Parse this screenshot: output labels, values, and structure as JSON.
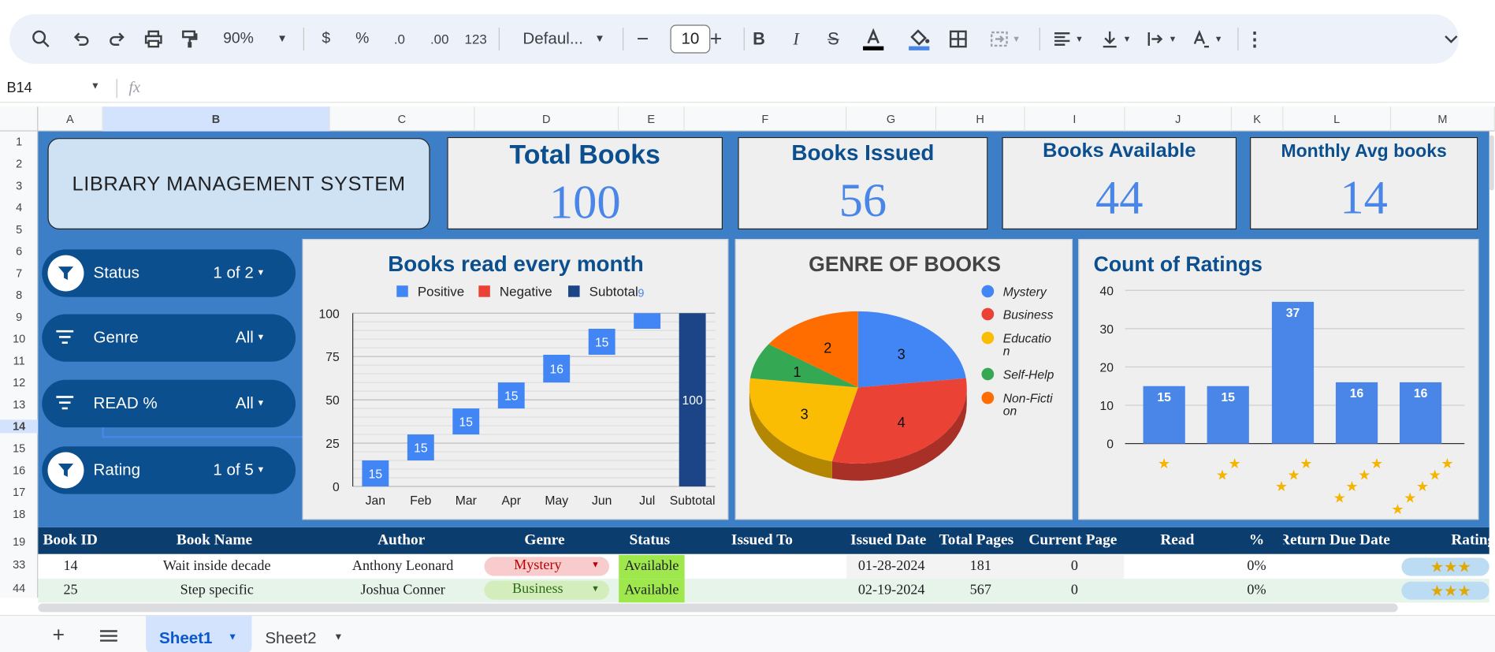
{
  "toolbar": {
    "zoom": "90%",
    "currency": "$",
    "percent": "%",
    "dec_less": ".0",
    "dec_more": ".00",
    "format_123": "123",
    "font": "Defaul...",
    "font_size": "10"
  },
  "formula": {
    "cell_ref": "B14",
    "fx": "fx"
  },
  "columns": [
    "A",
    "B",
    "C",
    "D",
    "E",
    "F",
    "G",
    "H",
    "I",
    "J",
    "K",
    "L",
    "M"
  ],
  "rows": [
    "1",
    "2",
    "3",
    "4",
    "5",
    "6",
    "7",
    "8",
    "9",
    "10",
    "11",
    "12",
    "13",
    "14",
    "15",
    "16",
    "17",
    "18",
    "19",
    "33",
    "44"
  ],
  "title": "LIBRARY MANAGEMENT SYSTEM",
  "kpis": [
    {
      "title": "Total Books",
      "value": "100"
    },
    {
      "title": "Books Issued",
      "value": "56"
    },
    {
      "title": "Books Available",
      "value": "44"
    },
    {
      "title": "Monthly Avg books",
      "value": "14"
    }
  ],
  "filters": [
    {
      "label": "Status",
      "value": "1 of 2",
      "icon": "funnel-icon"
    },
    {
      "label": "Genre",
      "value": "All",
      "icon": "filter-lines-icon"
    },
    {
      "label": "READ %",
      "value": "All",
      "icon": "filter-lines-icon"
    },
    {
      "label": "Rating",
      "value": "1 of 5",
      "icon": "funnel-icon"
    }
  ],
  "chart_data": [
    {
      "type": "bar",
      "title": "Books read every month",
      "legend": [
        "Positive",
        "Negative",
        "Subtotal"
      ],
      "legend_page": "9",
      "colors": {
        "positive": "#4285f4",
        "negative": "#ea4335",
        "subtotal": "#1c4587"
      },
      "categories": [
        "Jan",
        "Feb",
        "Mar",
        "Apr",
        "May",
        "Jun",
        "Jul",
        "Subtotal"
      ],
      "values": [
        15,
        15,
        15,
        15,
        16,
        15,
        9,
        100
      ],
      "labels": [
        "15",
        "15",
        "15",
        "15",
        "16",
        "15",
        "",
        "100"
      ],
      "ylim": [
        0,
        100
      ],
      "yticks": [
        "0",
        "25",
        "50",
        "75",
        "100"
      ]
    },
    {
      "type": "pie",
      "title": "GENRE OF BOOKS",
      "labels": [
        "Mystery",
        "Business",
        "Educatio n",
        "Self-Help",
        "Non-Ficti on"
      ],
      "values": [
        3,
        4,
        3,
        1,
        2
      ],
      "value_labels": [
        "3",
        "4",
        "3",
        "1",
        "2"
      ],
      "colors": [
        "#4285f4",
        "#ea4335",
        "#fbbc04",
        "#34a853",
        "#ff6d01"
      ]
    },
    {
      "type": "bar",
      "title": "Count of Ratings",
      "categories": [
        "1 star",
        "2 stars",
        "3 stars",
        "4 stars",
        "5 stars"
      ],
      "values": [
        15,
        15,
        37,
        16,
        16
      ],
      "labels": [
        "15",
        "15",
        "37",
        "16",
        "16"
      ],
      "ylim": [
        0,
        40
      ],
      "yticks": [
        "0",
        "10",
        "20",
        "30",
        "40"
      ]
    }
  ],
  "table": {
    "headers": [
      "Book ID",
      "Book Name",
      "Author",
      "Genre",
      "Status",
      "Issued To",
      "Issued Date",
      "Total Pages",
      "Current Page",
      "Read",
      "%",
      "Return Due Date",
      "Rating"
    ],
    "rows": [
      {
        "id": "14",
        "name": "Wait inside decade",
        "author": "Anthony Leonard",
        "genre": "Mystery",
        "status": "Available",
        "issued_to": "",
        "date": "01-28-2024",
        "pages": "181",
        "current": "0",
        "read": "",
        "pct": "0%",
        "due": "",
        "rating": "★★★"
      },
      {
        "id": "25",
        "name": "Step specific",
        "author": "Joshua Conner",
        "genre": "Business",
        "status": "Available",
        "issued_to": "",
        "date": "02-19-2024",
        "pages": "567",
        "current": "0",
        "read": "",
        "pct": "0%",
        "due": "",
        "rating": "★★★"
      }
    ]
  },
  "sheets": [
    "Sheet1",
    "Sheet2"
  ]
}
